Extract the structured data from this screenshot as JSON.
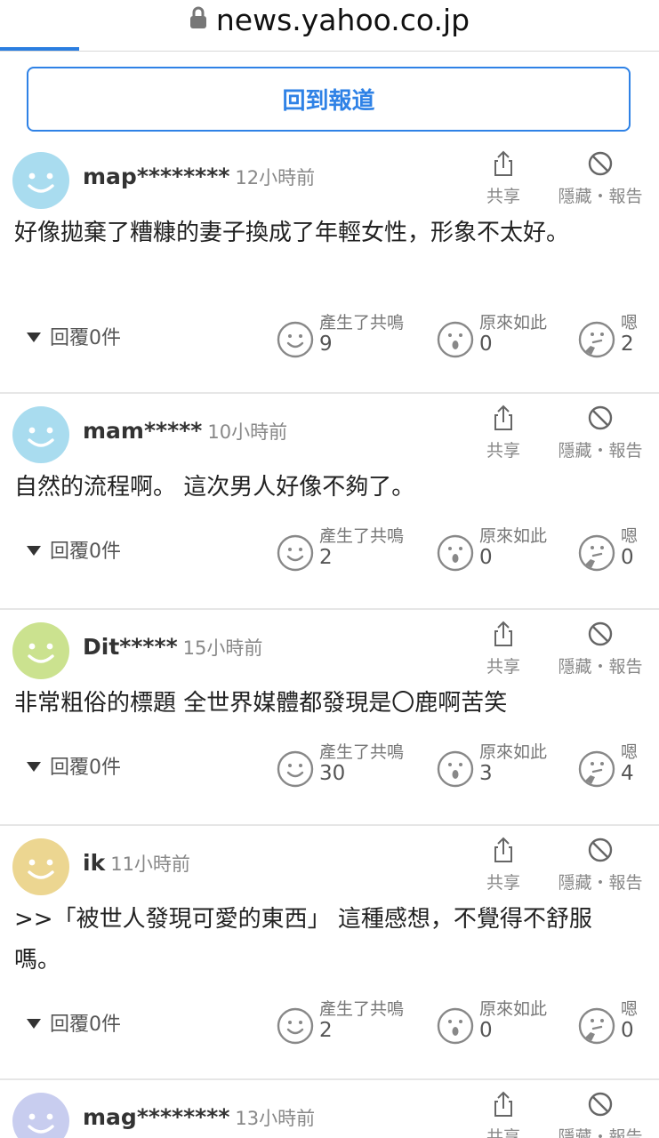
{
  "browser": {
    "url": "news.yahoo.co.jp",
    "lock_icon": "lock-icon",
    "progress": 0.12
  },
  "back_button": {
    "label": "回到報道"
  },
  "labels": {
    "share": "共享",
    "hide_report": "隱藏・報告",
    "react_empathy": "產生了共鳴",
    "react_insight": "原來如此",
    "react_hmm": "嗯"
  },
  "comments": [
    {
      "user": "map********",
      "time": "12小時前",
      "avatar_color": "#a9dcef",
      "text": "好像拋棄了糟糠的妻子換成了年輕女性，形象不太好。",
      "reply": "回覆0件",
      "empathy": "9",
      "insight": "0",
      "hmm": "2"
    },
    {
      "user": "mam*****",
      "time": "10小時前",
      "avatar_color": "#a9dcef",
      "text": "自然的流程啊。 這次男人好像不夠了。",
      "reply": "回覆0件",
      "empathy": "2",
      "insight": "0",
      "hmm": "0"
    },
    {
      "user": "Dit*****",
      "time": "15小時前",
      "avatar_color": "#cbe28f",
      "text": "非常粗俗的標題 全世界媒體都發現是〇鹿啊苦笑",
      "reply": "回覆0件",
      "empathy": "30",
      "insight": "3",
      "hmm": "4"
    },
    {
      "user": "ik",
      "time": "11小時前",
      "avatar_color": "#ecd691",
      "text": ">>「被世人發現可愛的東西」 這種感想，不覺得不舒服嗎。",
      "reply": "回覆0件",
      "empathy": "2",
      "insight": "0",
      "hmm": "0"
    },
    {
      "user": "mag********",
      "time": "13小時前",
      "avatar_color": "#c8cdef"
    }
  ]
}
